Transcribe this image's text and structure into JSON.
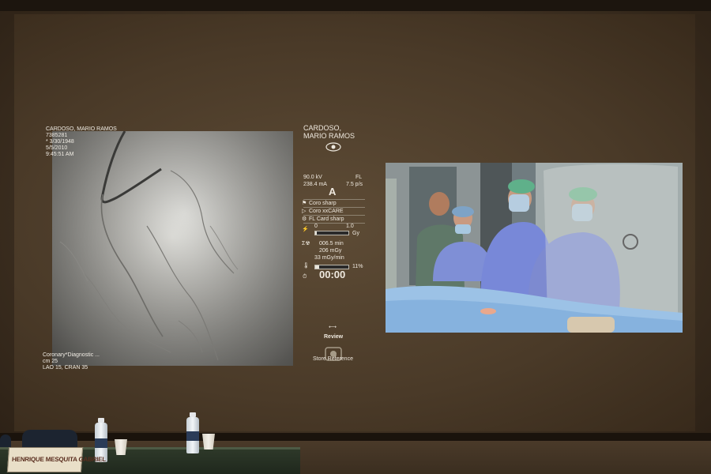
{
  "fluoro": {
    "overlay_top": [
      "CARDOSO, MARIO RAMOS",
      "7385281",
      "* 3/30/1948",
      "5/5/2010",
      "9:45:51 AM"
    ],
    "overlay_bottom": [
      "Coronary*Diagnostic ...",
      "cm 25",
      "LAO 15, CRAN 35"
    ]
  },
  "panel": {
    "patient_name_1": "CARDOSO,",
    "patient_name_2": "MARIO RAMOS",
    "eye_icon": "eye-icon",
    "kv": "90.0 kV",
    "fl": "FL",
    "ma": "238.4 mA",
    "pps": "7.5 p/s",
    "mode": "A",
    "protocols": [
      "Coro sharp",
      "Coro xxCARE",
      "FL Card sharp"
    ],
    "dose_scale_min": "0",
    "dose_scale_max": "1.0",
    "dose_unit": "Gy",
    "dose_fill": 0.05,
    "time": "006.5 min",
    "dose": "206 mGy",
    "rate": "33 mGy/min",
    "percent": "11%",
    "percent_fill": 0.11,
    "timer": "00:00",
    "review_label": "Review",
    "store_label": "Store Reference"
  },
  "nameplate": "HENRIQUE MESQUITA GABRIEL"
}
